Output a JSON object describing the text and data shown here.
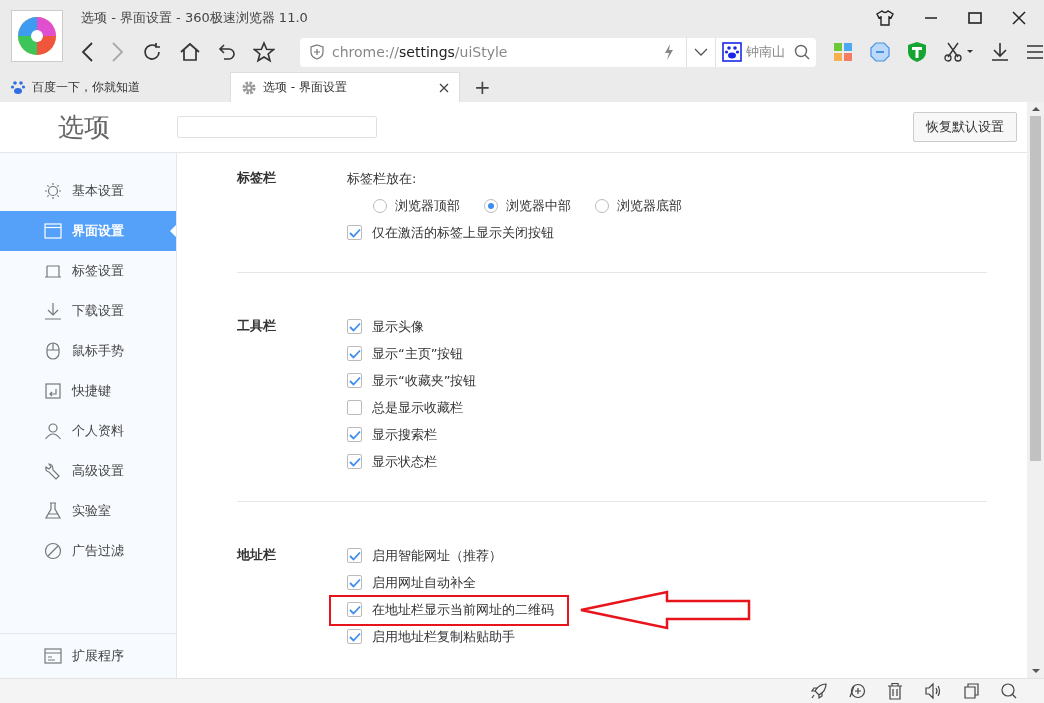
{
  "window": {
    "title": "选项 - 界面设置 - 360极速浏览器 11.0"
  },
  "address_bar": {
    "prefix": "chrome://",
    "host": "settings",
    "path": "/uiStyle"
  },
  "search_box": {
    "value": "钟南山"
  },
  "tabs": [
    {
      "label": "百度一下，你就知道",
      "selected": false
    },
    {
      "label": "选项 - 界面设置",
      "selected": true
    }
  ],
  "new_tab": "+",
  "page": {
    "heading": "选项",
    "restore_button": "恢复默认设置"
  },
  "sidebar": {
    "items": [
      {
        "label": "基本设置",
        "selected": false
      },
      {
        "label": "界面设置",
        "selected": true
      },
      {
        "label": "标签设置",
        "selected": false
      },
      {
        "label": "下载设置",
        "selected": false
      },
      {
        "label": "鼠标手势",
        "selected": false
      },
      {
        "label": "快捷键",
        "selected": false
      },
      {
        "label": "个人资料",
        "selected": false
      },
      {
        "label": "高级设置",
        "selected": false
      },
      {
        "label": "实验室",
        "selected": false
      },
      {
        "label": "广告过滤",
        "selected": false
      }
    ],
    "footer_item": {
      "label": "扩展程序",
      "selected": false
    }
  },
  "sections": [
    {
      "title": "标签栏",
      "items": [
        {
          "kind": "label",
          "label": "标签栏放在:"
        },
        {
          "kind": "radios",
          "options": [
            {
              "label": "浏览器顶部",
              "selected": false
            },
            {
              "label": "浏览器中部",
              "selected": true
            },
            {
              "label": "浏览器底部",
              "selected": false
            }
          ]
        },
        {
          "kind": "checkbox",
          "label": "仅在激活的标签上显示关闭按钮",
          "checked": true,
          "highlighted": false
        }
      ]
    },
    {
      "title": "工具栏",
      "items": [
        {
          "kind": "checkbox",
          "label": "显示头像",
          "checked": true,
          "highlighted": false
        },
        {
          "kind": "checkbox",
          "label": "显示“主页”按钮",
          "checked": true,
          "highlighted": false
        },
        {
          "kind": "checkbox",
          "label": "显示“收藏夹”按钮",
          "checked": true,
          "highlighted": false
        },
        {
          "kind": "checkbox",
          "label": "总是显示收藏栏",
          "checked": false,
          "highlighted": false
        },
        {
          "kind": "checkbox",
          "label": "显示搜索栏",
          "checked": true,
          "highlighted": false
        },
        {
          "kind": "checkbox",
          "label": "显示状态栏",
          "checked": true,
          "highlighted": false
        }
      ]
    },
    {
      "title": "地址栏",
      "items": [
        {
          "kind": "checkbox",
          "label": "启用智能网址（推荐）",
          "checked": true,
          "highlighted": false
        },
        {
          "kind": "checkbox",
          "label": "启用网址自动补全",
          "checked": true,
          "highlighted": false
        },
        {
          "kind": "checkbox",
          "label": "在地址栏显示当前网址的二维码",
          "checked": true,
          "highlighted": true
        },
        {
          "kind": "checkbox",
          "label": "启用地址栏复制粘贴助手",
          "checked": true,
          "highlighted": false
        }
      ]
    }
  ]
}
